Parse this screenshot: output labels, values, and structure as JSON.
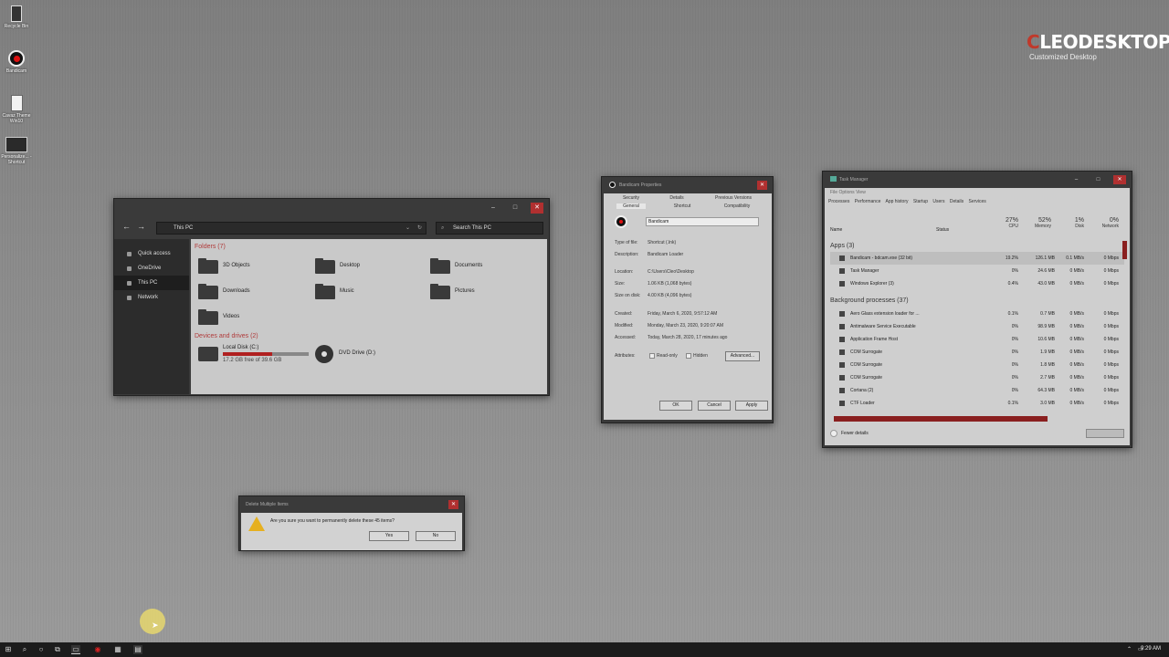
{
  "desktop": {
    "icons": [
      {
        "label": "Recycle Bin",
        "icon": "recycle-bin-icon"
      },
      {
        "label": "Bandicam",
        "icon": "bandicam-icon"
      },
      {
        "label": "Cavaz Theme Win10",
        "icon": "document-icon"
      },
      {
        "label": "Personalize... - Shortcut",
        "icon": "monitor-icon"
      }
    ],
    "brand_prefix": "C",
    "brand_name": "LEODESKTOP",
    "brand_sub": "Customized Desktop"
  },
  "explorer": {
    "address": "This PC",
    "search_placeholder": "Search This PC",
    "sidebar": [
      {
        "label": "Quick access"
      },
      {
        "label": "OneDrive"
      },
      {
        "label": "This PC"
      },
      {
        "label": "Network"
      }
    ],
    "folders_header": "Folders (7)",
    "folders": [
      {
        "label": "3D Objects"
      },
      {
        "label": "Desktop"
      },
      {
        "label": "Documents"
      },
      {
        "label": "Downloads"
      },
      {
        "label": "Music"
      },
      {
        "label": "Pictures"
      },
      {
        "label": "Videos"
      }
    ],
    "drives_header": "Devices and drives (2)",
    "drives": [
      {
        "label": "Local Disk (C:)",
        "free": "17.2 GB free of 39.6 GB",
        "used_fraction": 0.57
      },
      {
        "label": "DVD Drive (D:)"
      }
    ]
  },
  "properties": {
    "title": "Bandicam Properties",
    "tabs_row1": [
      "Security",
      "Details",
      "Previous Versions"
    ],
    "tabs_row2": [
      "General",
      "Shortcut",
      "Compatibility"
    ],
    "name": "Bandicam",
    "rows": [
      {
        "k": "Type of file:",
        "v": "Shortcut (.lnk)"
      },
      {
        "k": "Description:",
        "v": "Bandicam Loader"
      },
      {
        "k": "Location:",
        "v": "C:\\Users\\Cleo\\Desktop"
      },
      {
        "k": "Size:",
        "v": "1.06 KB (1,068 bytes)"
      },
      {
        "k": "Size on disk:",
        "v": "4.00 KB (4,096 bytes)"
      },
      {
        "k": "Created:",
        "v": "Friday, March 6, 2020, 9:57:12 AM"
      },
      {
        "k": "Modified:",
        "v": "Monday, March 23, 2020, 9:20:07 AM"
      },
      {
        "k": "Accessed:",
        "v": "Today, March 28, 2020, 17 minutes ago"
      }
    ],
    "attributes_label": "Attributes:",
    "readonly": "Read-only",
    "hidden": "Hidden",
    "advanced": "Advanced...",
    "ok": "OK",
    "cancel": "Cancel",
    "apply": "Apply"
  },
  "taskmgr": {
    "title": "Task Manager",
    "menu": "File   Options   View",
    "tabs": [
      "Processes",
      "Performance",
      "App history",
      "Startup",
      "Users",
      "Details",
      "Services"
    ],
    "col_name": "Name",
    "col_status": "Status",
    "cpu_pct": "27%",
    "cpu": "CPU",
    "mem_pct": "52%",
    "mem": "Memory",
    "disk_pct": "1%",
    "disk": "Disk",
    "net_pct": "0%",
    "net": "Network",
    "apps_header": "Apps (3)",
    "apps": [
      {
        "name": "Bandicam - bdcam.exe (32 bit)",
        "cpu": "19.2%",
        "mem": "126.1 MB",
        "disk": "0.1 MB/s",
        "net": "0 Mbps"
      },
      {
        "name": "Task Manager",
        "cpu": "0%",
        "mem": "24.6 MB",
        "disk": "0 MB/s",
        "net": "0 Mbps"
      },
      {
        "name": "Windows Explorer (3)",
        "cpu": "0.4%",
        "mem": "43.0 MB",
        "disk": "0 MB/s",
        "net": "0 Mbps"
      }
    ],
    "bg_header": "Background processes (37)",
    "bg": [
      {
        "name": "Aero Glass extension loader for ...",
        "cpu": "0.1%",
        "mem": "0.7 MB",
        "disk": "0 MB/s",
        "net": "0 Mbps"
      },
      {
        "name": "Antimalware Service Executable",
        "cpu": "0%",
        "mem": "98.9 MB",
        "disk": "0 MB/s",
        "net": "0 Mbps"
      },
      {
        "name": "Application Frame Host",
        "cpu": "0%",
        "mem": "10.6 MB",
        "disk": "0 MB/s",
        "net": "0 Mbps"
      },
      {
        "name": "COM Surrogate",
        "cpu": "0%",
        "mem": "1.9 MB",
        "disk": "0 MB/s",
        "net": "0 Mbps"
      },
      {
        "name": "COM Surrogate",
        "cpu": "0%",
        "mem": "1.8 MB",
        "disk": "0 MB/s",
        "net": "0 Mbps"
      },
      {
        "name": "COM Surrogate",
        "cpu": "0%",
        "mem": "2.7 MB",
        "disk": "0 MB/s",
        "net": "0 Mbps"
      },
      {
        "name": "Cortana (2)",
        "cpu": "0%",
        "mem": "64.3 MB",
        "disk": "0 MB/s",
        "net": "0 Mbps"
      },
      {
        "name": "CTF Loader",
        "cpu": "0.1%",
        "mem": "3.0 MB",
        "disk": "0 MB/s",
        "net": "0 Mbps"
      }
    ],
    "fewer_details": "Fewer details"
  },
  "dialog": {
    "title": "Delete Multiple Items",
    "message": "Are you sure you want to permanently delete these 45 items?",
    "yes": "Yes",
    "no": "No"
  },
  "taskbar": {
    "time": "9:29 AM"
  }
}
